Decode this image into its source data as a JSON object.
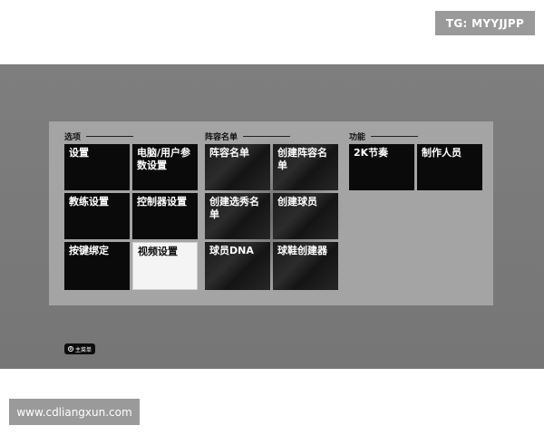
{
  "top_badge": "TG: MYYJJPP",
  "sections": {
    "options": {
      "title": "选项",
      "tiles": [
        "设置",
        "电脑/用户参数设置",
        "教练设置",
        "控制器设置",
        "按键绑定",
        "视频设置"
      ]
    },
    "roster": {
      "title": "阵容名单",
      "tiles": [
        "阵容名单",
        "创建阵容名单",
        "创建选秀名单",
        "创建球员",
        "球员DNA",
        "球鞋创建器"
      ]
    },
    "features": {
      "title": "功能",
      "tiles": [
        "2K节奏",
        "制作人员"
      ]
    }
  },
  "selected_tile": "视频设置",
  "main_menu_button": {
    "icon": "circle-b-icon",
    "icon_glyph": "B",
    "label": "主菜单"
  },
  "watermark": "www.cdliangxun.com"
}
